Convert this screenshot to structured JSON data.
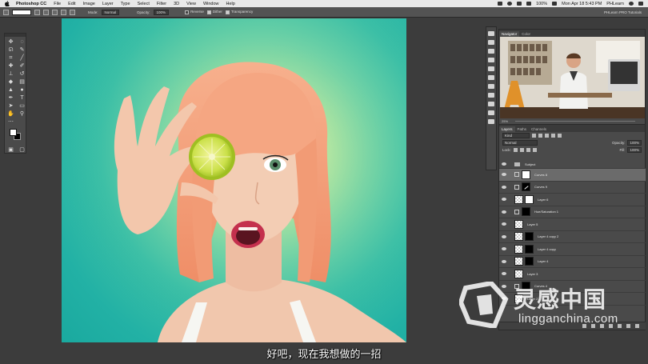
{
  "menubar": {
    "app_name": "Photoshop CC",
    "menus": [
      "File",
      "Edit",
      "Image",
      "Layer",
      "Type",
      "Select",
      "Filter",
      "3D",
      "View",
      "Window",
      "Help"
    ],
    "clock": "Mon Apr 18  5:43 PM",
    "user": "PHLearn",
    "battery": "100%"
  },
  "options_bar": {
    "mode_label": "Mode:",
    "mode_value": "Normal",
    "opacity_label": "Opacity:",
    "opacity_value": "100%",
    "reverse_label": "Reverse",
    "dither_label": "Dither",
    "transparency_label": "Transparency",
    "reverse_checked": false,
    "dither_checked": true,
    "transparency_checked": true,
    "workspace_label": "PHLearn PRO Tutorials"
  },
  "navigator": {
    "tabs": [
      "Navigator",
      "Color"
    ],
    "zoom": "25%"
  },
  "layers_panel": {
    "tabs": [
      "Layers",
      "Paths",
      "Channels"
    ],
    "kind_filter": "Kind",
    "blend_mode": "Normal",
    "opacity_label": "Opacity:",
    "opacity_value": "100%",
    "lock_label": "Lock:",
    "fill_label": "Fill:",
    "fill_value": "100%",
    "group_name": "Subject",
    "layers": [
      {
        "name": "Curves 8",
        "kind": "curves",
        "mask": "white",
        "selected": true
      },
      {
        "name": "Curves 9",
        "kind": "curves",
        "mask": "curve",
        "selected": false
      },
      {
        "name": "Layer 6",
        "kind": "pixel",
        "mask": "white",
        "selected": false
      },
      {
        "name": "Hue/Saturation 1",
        "kind": "huesat",
        "mask": "black",
        "selected": false
      },
      {
        "name": "Layer 5",
        "kind": "pixel",
        "mask": "none",
        "selected": false
      },
      {
        "name": "Layer 4 copy 2",
        "kind": "pixel",
        "mask": "black",
        "selected": false
      },
      {
        "name": "Layer 4 copy",
        "kind": "pixel",
        "mask": "black",
        "selected": false
      },
      {
        "name": "Layer 4",
        "kind": "pixel",
        "mask": "black",
        "selected": false
      },
      {
        "name": "Layer 3",
        "kind": "pixel",
        "mask": "none",
        "selected": false
      },
      {
        "name": "Curves 4",
        "kind": "curves",
        "mask": "black",
        "selected": false
      },
      {
        "name": "Layer 2",
        "kind": "pixel",
        "mask": "none",
        "selected": false
      }
    ]
  },
  "subtitle": "好吧，现在我想做的一招",
  "watermark": {
    "title": "灵感中国",
    "url": "lingganchina.com"
  },
  "colors": {
    "panel_bg": "#4a4a4a",
    "app_bg": "#3c3c3c",
    "canvas_teal": "#1aa99f",
    "canvas_center": "#d9ee9a",
    "hair": "#f4a07a"
  }
}
